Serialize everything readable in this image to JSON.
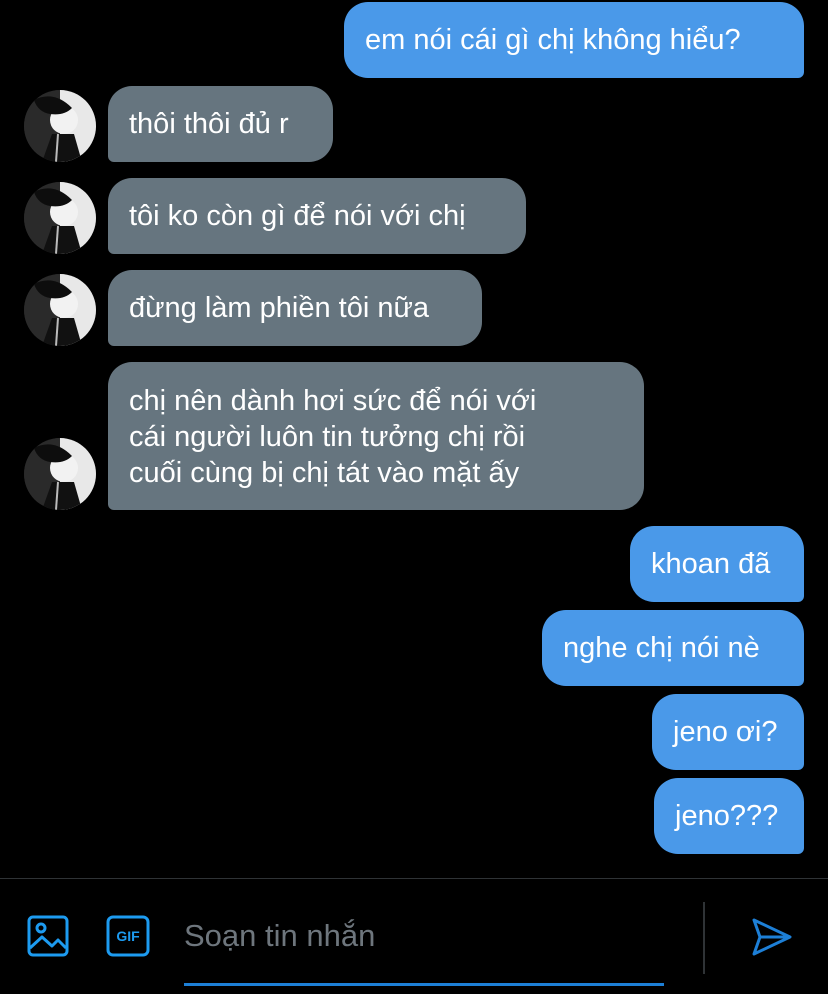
{
  "colors": {
    "background": "#000000",
    "sent_bubble": "#4a99e9",
    "received_bubble": "#66757f",
    "accent": "#1d9bf0"
  },
  "messages": [
    {
      "from": "me",
      "text": "em nói cái gì chị không hiểu?"
    },
    {
      "from": "them",
      "text": "thôi thôi đủ r"
    },
    {
      "from": "them",
      "text": "tôi ko còn gì để nói với chị"
    },
    {
      "from": "them",
      "text": "đừng làm phiền tôi nữa"
    },
    {
      "from": "them",
      "lines": [
        "chị nên dành hơi sức để nói với",
        "cái người luôn tin tưởng chị rồi",
        "cuối cùng bị chị tát vào mặt ấy"
      ]
    },
    {
      "from": "me",
      "text": "khoan đã"
    },
    {
      "from": "me",
      "text": "nghe chị nói nè"
    },
    {
      "from": "me",
      "text": "jeno ơi?"
    },
    {
      "from": "me",
      "text": "jeno???"
    }
  ],
  "composer": {
    "placeholder": "Soạn tin nhắn",
    "value": "",
    "media_icon": "image-icon",
    "gif_icon": "gif-icon",
    "gif_label": "GIF",
    "send_icon": "send-icon"
  }
}
